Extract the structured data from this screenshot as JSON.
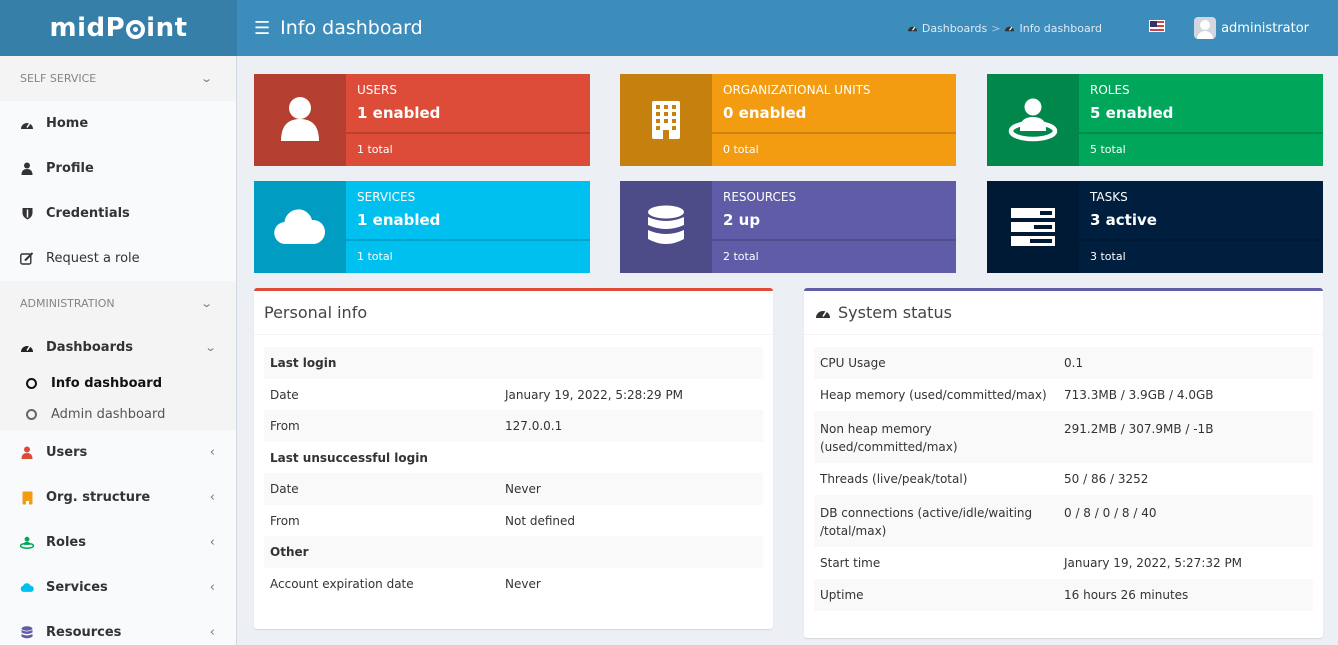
{
  "header": {
    "logo": {
      "left": "midP",
      "right": "int"
    },
    "page_title": "Info dashboard",
    "breadcrumb": [
      "Dashboards",
      "Info dashboard"
    ],
    "breadcrumb_separator": ">",
    "username": "administrator"
  },
  "sidebar": {
    "self_service": {
      "label": "SELF SERVICE",
      "items": [
        {
          "label": "Home",
          "icon": "dashboard-icon"
        },
        {
          "label": "Profile",
          "icon": "user-icon"
        },
        {
          "label": "Credentials",
          "icon": "shield-icon"
        },
        {
          "label": "Request a role",
          "icon": "edit-icon"
        }
      ]
    },
    "administration": {
      "label": "ADMINISTRATION",
      "dashboards": "Dashboards",
      "sub_items": [
        {
          "label": "Info dashboard"
        },
        {
          "label": "Admin dashboard"
        }
      ],
      "items": [
        {
          "label": "Users",
          "icon": "user-icon",
          "color": "#dd4b39"
        },
        {
          "label": "Org. structure",
          "icon": "building-icon",
          "color": "#f39c12"
        },
        {
          "label": "Roles",
          "icon": "role-icon",
          "color": "#00a65a"
        },
        {
          "label": "Services",
          "icon": "cloud-icon",
          "color": "#00c0ef"
        },
        {
          "label": "Resources",
          "icon": "database-icon",
          "color": "#605ca8"
        }
      ]
    }
  },
  "tiles": [
    {
      "title": "USERS",
      "value": "1 enabled",
      "footer": "1 total",
      "color": "#dd4b39",
      "icon_bg": "#b43e2f"
    },
    {
      "title": "ORGANIZATIONAL UNITS",
      "value": "0 enabled",
      "footer": "0 total",
      "color": "#f39c12",
      "icon_bg": "#c6800e"
    },
    {
      "title": "ROLES",
      "value": "5 enabled",
      "footer": "5 total",
      "color": "#00a65a",
      "icon_bg": "#008749"
    },
    {
      "title": "SERVICES",
      "value": "1 enabled",
      "footer": "1 total",
      "color": "#00c0ef",
      "icon_bg": "#009cc2"
    },
    {
      "title": "RESOURCES",
      "value": "2 up",
      "footer": "2 total",
      "color": "#605ca8",
      "icon_bg": "#4e4b89"
    },
    {
      "title": "TASKS",
      "value": "3 active",
      "footer": "3 total",
      "color": "#001f3f",
      "icon_bg": "#001a35"
    }
  ],
  "personal_info": {
    "title": "Personal info",
    "rows": [
      {
        "label": "Last login",
        "value": "",
        "group": true
      },
      {
        "label": "Date",
        "value": "January 19, 2022, 5:28:29 PM"
      },
      {
        "label": "From",
        "value": "127.0.0.1"
      },
      {
        "label": "Last unsuccessful login",
        "value": "",
        "group": true
      },
      {
        "label": "Date",
        "value": "Never"
      },
      {
        "label": "From",
        "value": "Not defined"
      },
      {
        "label": "Other",
        "value": "",
        "group": true
      },
      {
        "label": "Account expiration date",
        "value": "Never"
      }
    ]
  },
  "system_status": {
    "title": "System status",
    "rows": [
      {
        "label": "CPU Usage",
        "value": "0.1"
      },
      {
        "label": "Heap memory (used/committed/max)",
        "value": "713.3MB / 3.9GB / 4.0GB"
      },
      {
        "label": "Non heap memory (used/committed/max)",
        "value": "291.2MB / 307.9MB / -1B"
      },
      {
        "label": "Threads (live/peak/total)",
        "value": "50 / 86 / 3252"
      },
      {
        "label": "DB connections (active/idle/waiting /total/max)",
        "value": "0 / 8 / 0 / 8 / 40"
      },
      {
        "label": "Start time",
        "value": "January 19, 2022, 5:27:32 PM"
      },
      {
        "label": "Uptime",
        "value": "16 hours 26 minutes"
      }
    ]
  },
  "colors": {
    "header": "#3c8dbc",
    "logo_bg": "#367fa9",
    "personal_info_border": "#dd4b39",
    "system_status_border": "#605ca8"
  }
}
